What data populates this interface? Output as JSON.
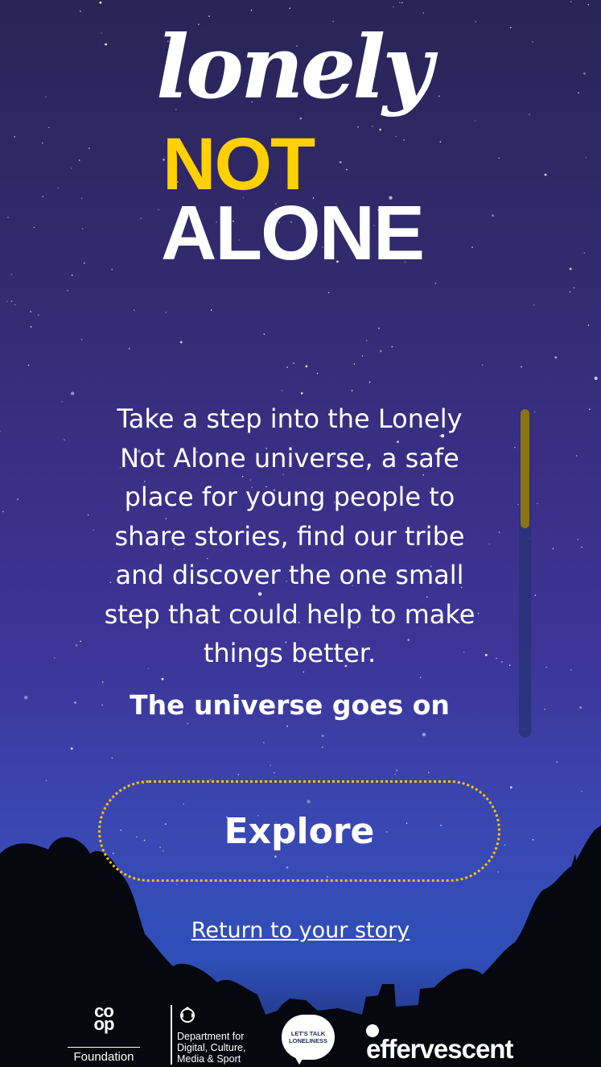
{
  "logo": {
    "line1": "lonely",
    "line2": "NOT",
    "line3": "ALONE",
    "colors": {
      "lonely": "#ffffff",
      "not": "#ffd100",
      "alone": "#ffffff"
    }
  },
  "intro": {
    "body": "Take a step into the Lonely Not Alone universe, a safe place for young people to share stories, find our tribe and discover the one small step that could help to make things better.",
    "subheading": "The universe goes on"
  },
  "scroll": {
    "position_fraction": 0
  },
  "actions": {
    "explore_label": "Explore",
    "return_label": "Return to your story"
  },
  "footer": {
    "coop": {
      "mark_top": "co",
      "mark_bottom": "op",
      "label": "Foundation"
    },
    "dcms": {
      "line1": "Department for",
      "line2": "Digital, Culture,",
      "line3": "Media & Sport"
    },
    "lets_talk": {
      "line1": "LET'S TALK",
      "line2": "LONELINESS"
    },
    "effervescent": "effervescent"
  },
  "colors": {
    "accent_yellow": "#ffd100",
    "button_border": "#f4c400",
    "scroll_thumb": "#8a7412",
    "sky_top": "#2a2457",
    "sky_bottom": "#2f4fb8"
  }
}
